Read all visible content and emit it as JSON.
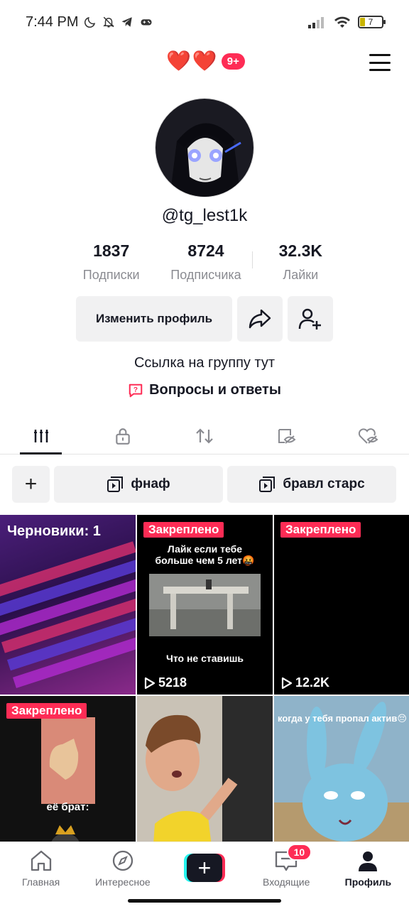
{
  "status_bar": {
    "time": "7:44 PM",
    "battery": "7"
  },
  "header": {
    "hearts": [
      "❤️",
      "❤️"
    ],
    "hearts_badge": "9+"
  },
  "profile": {
    "username": "@tg_lest1k",
    "stats": [
      {
        "value": "1837",
        "label": "Подписки"
      },
      {
        "value": "8724",
        "label": "Подписчика"
      },
      {
        "value": "32.3K",
        "label": "Лайки"
      }
    ],
    "edit_button": "Изменить профиль",
    "bio": "Ссылка на группу тут",
    "qa_link": "Вопросы и ответы"
  },
  "tabs": [
    "videos-grid-icon",
    "lock-icon",
    "repost-icon",
    "hidden-eye-icon",
    "liked-heart-icon"
  ],
  "playlists": [
    {
      "label": "фнаф"
    },
    {
      "label": "бравл старс"
    }
  ],
  "grid": {
    "drafts_label": "Черновики: 1",
    "pinned_label": "Закреплено",
    "items": [
      {
        "views": ""
      },
      {
        "views": "5218",
        "top_text": "Лайк если тебе больше чем 5 лет🤬",
        "bottom_text": "Что не ставишь"
      },
      {
        "views": "12.2K"
      },
      {
        "views": "",
        "caption": "её брат:"
      },
      {
        "views": ""
      },
      {
        "views": "",
        "caption": "когда у тебя пропал актив😔"
      }
    ]
  },
  "bottom_nav": {
    "home": "Главная",
    "discover": "Интересное",
    "inbox": "Входящие",
    "inbox_badge": "10",
    "profile": "Профиль"
  },
  "colors": {
    "accent": "#fe2c55",
    "cyan": "#25f4ee",
    "text": "#161823",
    "muted": "#8a8b91"
  }
}
